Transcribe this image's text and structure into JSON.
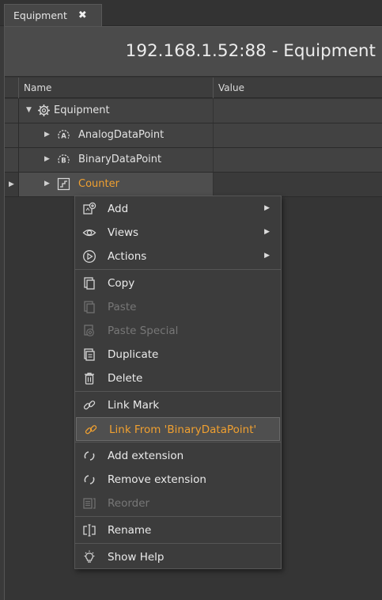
{
  "tab": {
    "label": "Equipment",
    "close_glyph": "✖"
  },
  "panel_title": "192.168.1.52:88 - Equipment",
  "columns": {
    "name": "Name",
    "value": "Value"
  },
  "tree": [
    {
      "label": "Equipment",
      "icon": "gear-icon",
      "expanded": true
    },
    {
      "label": "AnalogDataPoint",
      "icon": "analog-datapoint-icon",
      "badge": "A"
    },
    {
      "label": "BinaryDataPoint",
      "icon": "binary-datapoint-icon",
      "badge": "B"
    },
    {
      "label": "Counter",
      "icon": "counter-icon",
      "selected": true
    }
  ],
  "menu": {
    "add": "Add",
    "views": "Views",
    "actions": "Actions",
    "copy": "Copy",
    "paste": "Paste",
    "paste_special": "Paste Special",
    "duplicate": "Duplicate",
    "delete": "Delete",
    "link_mark": "Link Mark",
    "link_from": "Link From 'BinaryDataPoint'",
    "add_extension": "Add extension",
    "remove_extension": "Remove extension",
    "reorder": "Reorder",
    "rename": "Rename",
    "show_help": "Show Help"
  },
  "colors": {
    "accent": "#f0a030",
    "background": "#353535",
    "menu_bg": "#3c3c3c"
  }
}
